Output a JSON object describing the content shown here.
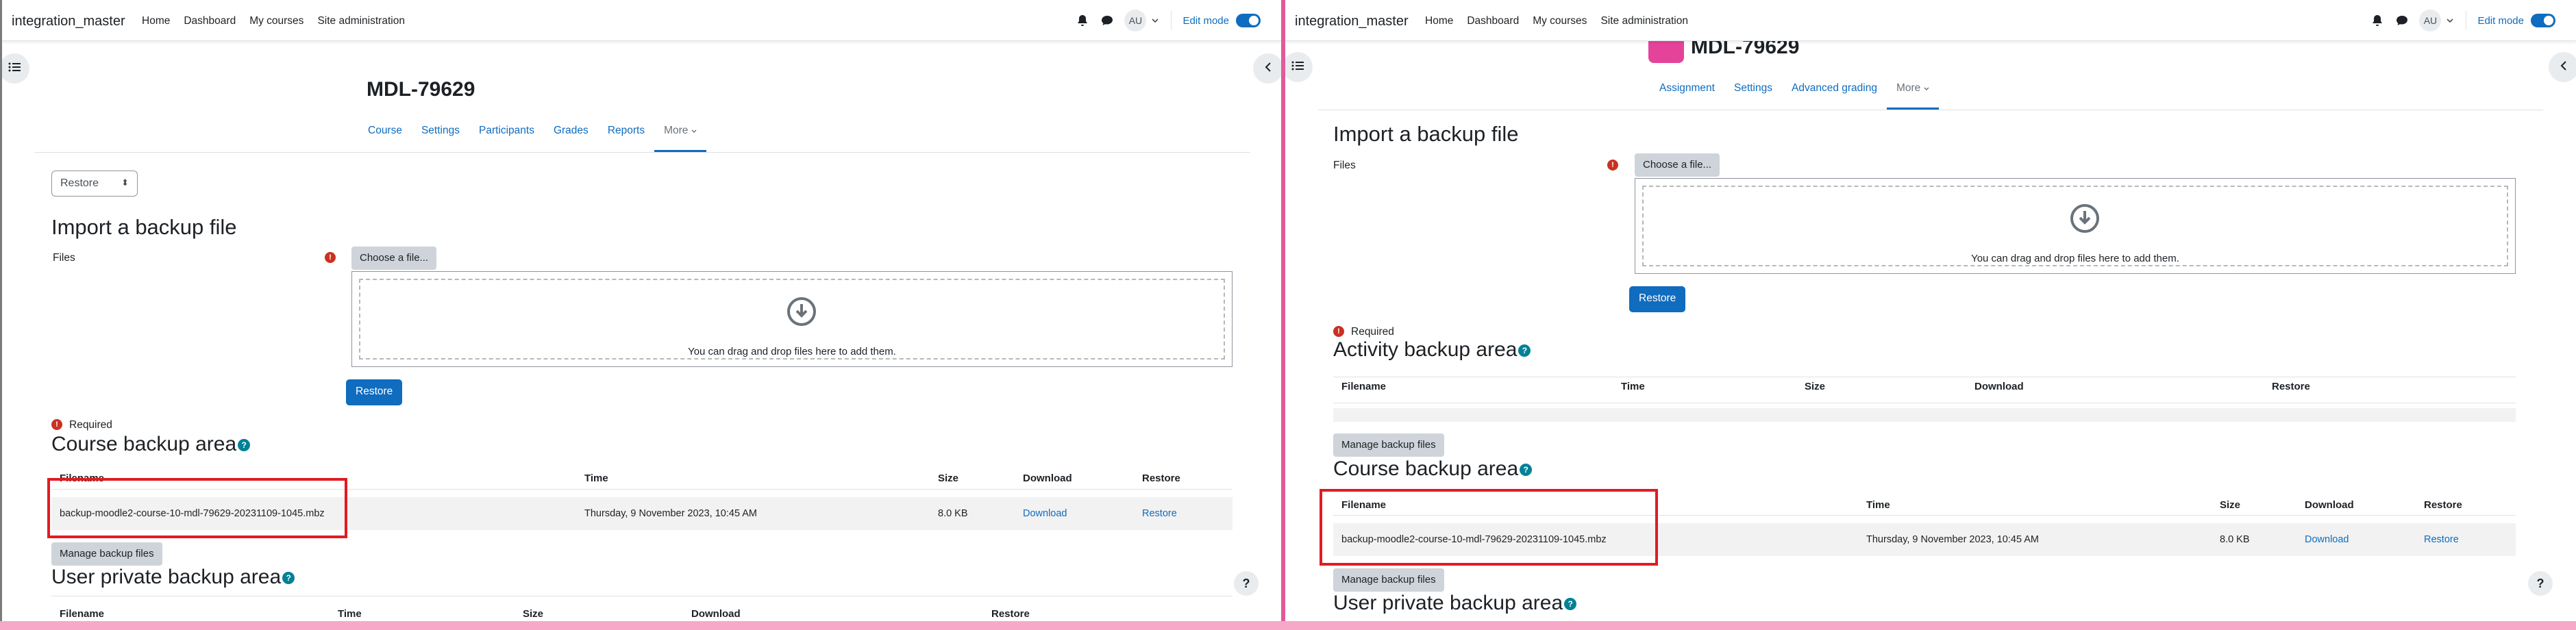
{
  "navbar": {
    "brand": "integration_master",
    "links": [
      "Home",
      "Dashboard",
      "My courses",
      "Site administration"
    ],
    "avatar": "AU",
    "edit_mode_label": "Edit mode",
    "icons": [
      "bell-icon",
      "chat-icon",
      "chevron-down-icon"
    ]
  },
  "left": {
    "course_title": "MDL-79629",
    "tabs": [
      "Course",
      "Settings",
      "Participants",
      "Grades",
      "Reports",
      "More"
    ],
    "select_value": "Restore",
    "import_heading": "Import a backup file",
    "files_label": "Files",
    "choose_file": "Choose a file...",
    "drop_text": "You can drag and drop files here to add them.",
    "restore_button": "Restore",
    "required_label": "Required",
    "course_backup_heading": "Course backup area",
    "table_headers": [
      "Filename",
      "Time",
      "Size",
      "Download",
      "Restore"
    ],
    "row": {
      "filename": "backup-moodle2-course-10-mdl-79629-20231109-1045.mbz",
      "time": "Thursday, 9 November 2023, 10:45 AM",
      "size": "8.0 KB",
      "download": "Download",
      "restore": "Restore"
    },
    "manage_button": "Manage backup files",
    "user_private_heading": "User private backup area",
    "user_table_headers": [
      "Filename",
      "Time",
      "Size",
      "Download",
      "Restore"
    ]
  },
  "right": {
    "course_title": "MDL-79629",
    "tabs": [
      "Assignment",
      "Settings",
      "Advanced grading",
      "More"
    ],
    "import_heading": "Import a backup file",
    "files_label": "Files",
    "choose_file": "Choose a file...",
    "drop_text": "You can drag and drop files here to add them.",
    "restore_button": "Restore",
    "required_label": "Required",
    "activity_backup_heading": "Activity backup area",
    "activity_table_headers": [
      "Filename",
      "Time",
      "Size",
      "Download",
      "Restore"
    ],
    "manage_button_1": "Manage backup files",
    "course_backup_heading": "Course backup area",
    "table_headers": [
      "Filename",
      "Time",
      "Size",
      "Download",
      "Restore"
    ],
    "row": {
      "filename": "backup-moodle2-course-10-mdl-79629-20231109-1045.mbz",
      "time": "Thursday, 9 November 2023, 10:45 AM",
      "size": "8.0 KB",
      "download": "Download",
      "restore": "Restore"
    },
    "manage_button_2": "Manage backup files",
    "user_private_heading": "User private backup area"
  },
  "help_glyph": "?",
  "required_glyph": "!",
  "info_glyph": "?",
  "colors": {
    "primary": "#0f6cbf",
    "highlight": "#e11b22",
    "required": "#ca3120",
    "help": "#008196"
  }
}
